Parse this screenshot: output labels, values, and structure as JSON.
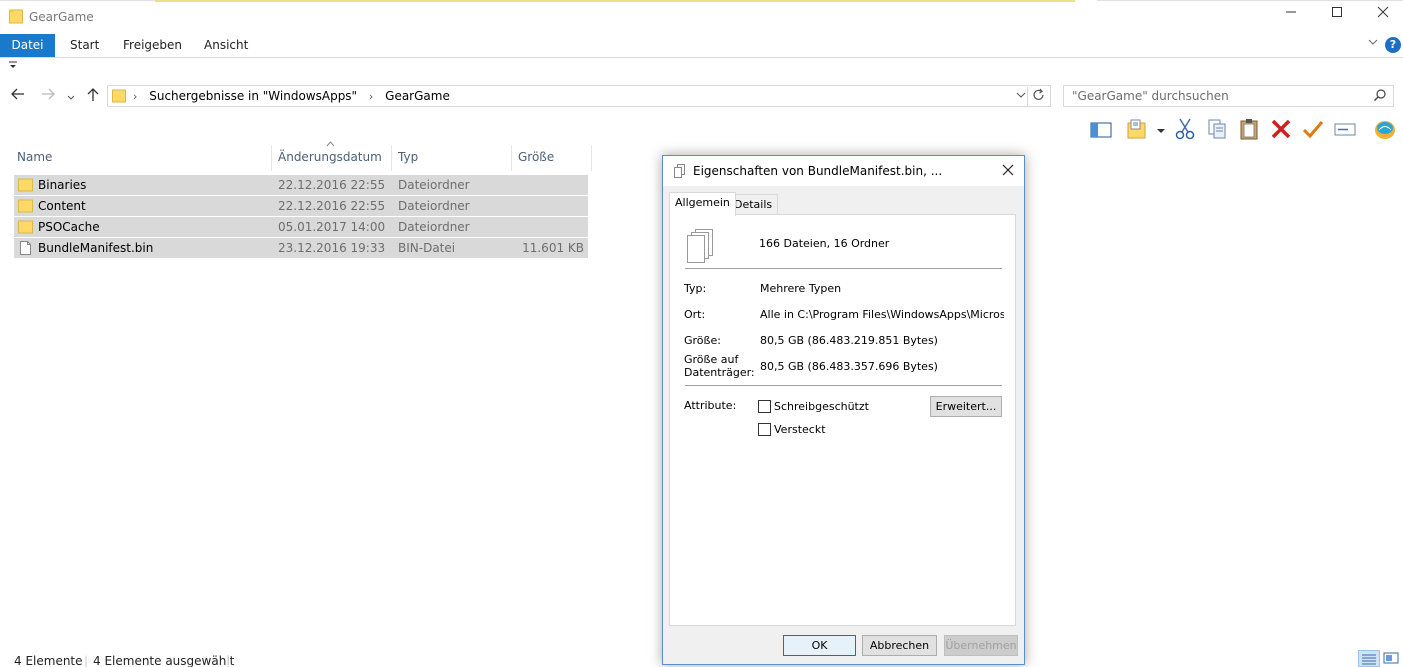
{
  "window": {
    "title": "GearGame",
    "minimize_icon": "minimize-icon",
    "maximize_icon": "maximize-icon",
    "close_icon": "close-icon"
  },
  "ribbon": {
    "tabs": [
      "Datei",
      "Start",
      "Freigeben",
      "Ansicht"
    ],
    "help": "?"
  },
  "address": {
    "crumbs": [
      "Suchergebnisse in \"WindowsApps\"",
      "GearGame"
    ],
    "search_placeholder": "\"GearGame\" durchsuchen"
  },
  "columns": {
    "name": "Name",
    "date": "Änderungsdatum",
    "type": "Typ",
    "size": "Größe"
  },
  "files": [
    {
      "name": "Binaries",
      "date": "22.12.2016 22:55",
      "type": "Dateiordner",
      "size": "",
      "icon": "folder-icon"
    },
    {
      "name": "Content",
      "date": "22.12.2016 22:55",
      "type": "Dateiordner",
      "size": "",
      "icon": "folder-icon"
    },
    {
      "name": "PSOCache",
      "date": "05.01.2017 14:00",
      "type": "Dateiordner",
      "size": "",
      "icon": "folder-icon"
    },
    {
      "name": "BundleManifest.bin",
      "date": "23.12.2016 19:33",
      "type": "BIN-Datei",
      "size": "11.601 KB",
      "icon": "file-icon"
    }
  ],
  "status": {
    "count": "4 Elemente",
    "selected": "4 Elemente ausgewählt"
  },
  "dialog": {
    "title": "Eigenschaften von BundleManifest.bin, ...",
    "tabs": [
      "Allgemein",
      "Details"
    ],
    "summary": "166 Dateien, 16 Ordner",
    "type_label": "Typ:",
    "type_value": "Mehrere Typen",
    "location_label": "Ort:",
    "location_value": "Alle in C:\\Program Files\\WindowsApps\\Microsoft.Sp",
    "size_label": "Größe:",
    "size_value": "80,5 GB (86.483.219.851 Bytes)",
    "disk_size_label_1": "Größe auf",
    "disk_size_label_2": "Datenträger:",
    "disk_size_value": "80,5 GB (86.483.357.696 Bytes)",
    "attributes_label": "Attribute:",
    "readonly_label": "Schreibgeschützt",
    "hidden_label": "Versteckt",
    "advanced_button": "Erweitert...",
    "ok_button": "OK",
    "cancel_button": "Abbrechen",
    "apply_button": "Übernehmen"
  },
  "colors": {
    "accent": "#1979ca",
    "selection": "#d9d9d9",
    "folder": "#ffd866"
  }
}
